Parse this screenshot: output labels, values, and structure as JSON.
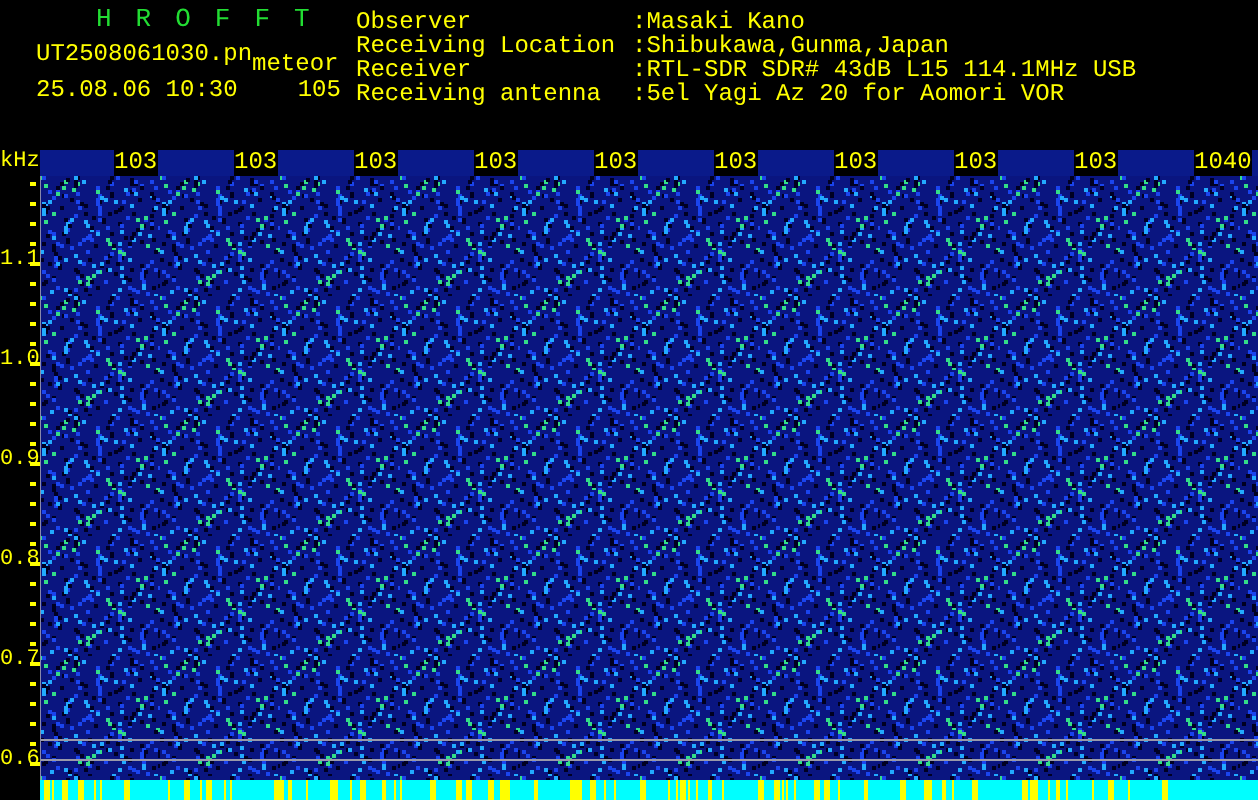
{
  "header": {
    "title": "HROFFT",
    "filename": "UT2508061030.pn",
    "filename_suffix": "meteor",
    "datetime": "25.08.06 10:30",
    "count": "105",
    "fields": [
      {
        "label": "Observer",
        "value": ":Masaki Kano"
      },
      {
        "label": "Receiving Location",
        "value": ":Shibukawa,Gunma,Japan"
      },
      {
        "label": "Receiver",
        "value": ":RTL-SDR SDR# 43dB L15 114.1MHz USB"
      },
      {
        "label": "Receiving antenna",
        "value": ":5el Yagi Az 20 for Aomori VOR"
      }
    ]
  },
  "x_axis": {
    "unit": "kHz",
    "labels": [
      "103",
      "103",
      "103",
      "103",
      "103",
      "103",
      "103",
      "103",
      "103",
      "1040"
    ]
  },
  "y_axis": {
    "labels": [
      "1.1",
      "1.0",
      "0.9",
      "0.8",
      "0.7",
      "0.6"
    ]
  }
}
